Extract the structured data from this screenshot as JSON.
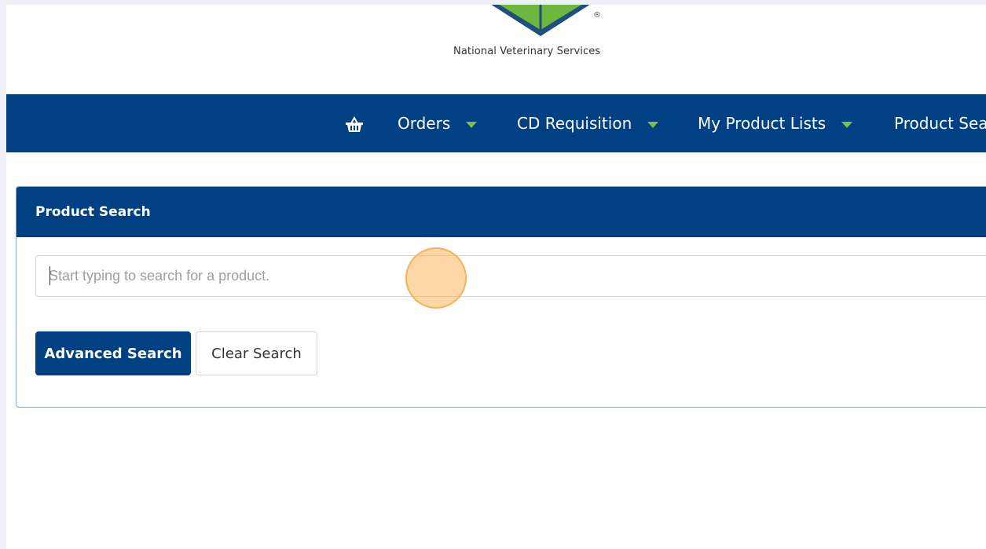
{
  "brand": {
    "name": "National Veterinary Services",
    "registered_mark": "®"
  },
  "nav": {
    "basket_icon": "basket-icon",
    "items": [
      {
        "label": "Orders"
      },
      {
        "label": "CD Requisition"
      },
      {
        "label": "My Product Lists"
      },
      {
        "label": "Product Search"
      }
    ]
  },
  "product_search": {
    "title": "Product Search",
    "placeholder": "Start typing to search for a product.",
    "value": "",
    "advanced_label": "Advanced Search",
    "clear_label": "Clear Search"
  },
  "colors": {
    "primary": "#004083",
    "accent": "#7dc142",
    "click_indicator": "#f5b25a"
  }
}
